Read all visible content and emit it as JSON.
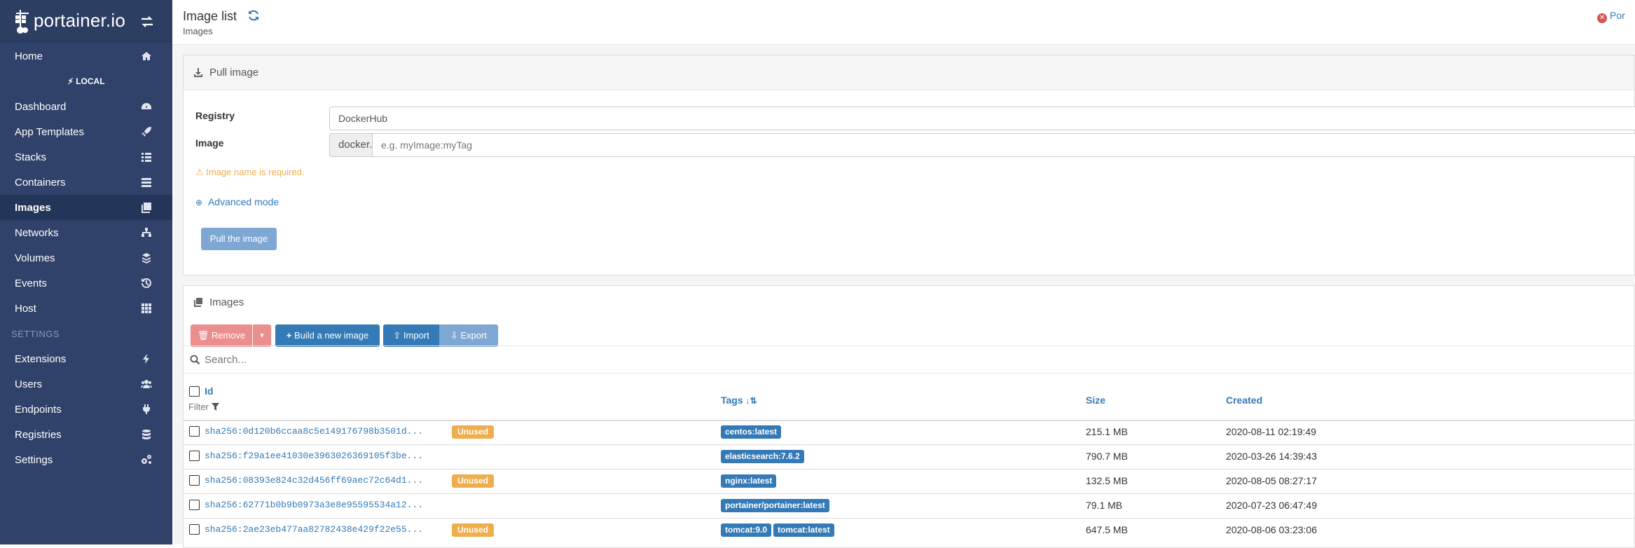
{
  "sidebar": {
    "logo_text": "portainer.io",
    "local_label": "LOCAL",
    "settings_section": "SETTINGS",
    "items": [
      {
        "label": "Home",
        "icon": "home-icon"
      },
      {
        "label": "Dashboard",
        "icon": "dashboard-icon"
      },
      {
        "label": "App Templates",
        "icon": "rocket-icon"
      },
      {
        "label": "Stacks",
        "icon": "stacks-icon"
      },
      {
        "label": "Containers",
        "icon": "containers-icon"
      },
      {
        "label": "Images",
        "icon": "images-icon",
        "active": true
      },
      {
        "label": "Networks",
        "icon": "networks-icon"
      },
      {
        "label": "Volumes",
        "icon": "volumes-icon"
      },
      {
        "label": "Events",
        "icon": "history-icon"
      },
      {
        "label": "Host",
        "icon": "grid-icon"
      },
      {
        "label": "Extensions",
        "icon": "bolt-icon"
      },
      {
        "label": "Users",
        "icon": "users-icon"
      },
      {
        "label": "Endpoints",
        "icon": "plug-icon"
      },
      {
        "label": "Registries",
        "icon": "database-icon"
      },
      {
        "label": "Settings",
        "icon": "cogs-icon"
      }
    ]
  },
  "header": {
    "title": "Image list",
    "breadcrumb": "Images",
    "user_text": "Por"
  },
  "pull_panel": {
    "title": "Pull image",
    "registry_label": "Registry",
    "registry_value": "DockerHub",
    "image_label": "Image",
    "image_prefix": "docker.io",
    "image_placeholder": "e.g. myImage:myTag",
    "warning": "Image name is required.",
    "advanced_mode": "Advanced mode",
    "pull_button": "Pull the image"
  },
  "images_panel": {
    "title": "Images",
    "remove_button": "Remove",
    "build_button": "Build a new image",
    "import_button": "Import",
    "export_button": "Export",
    "search_placeholder": "Search...",
    "columns": {
      "id": "Id",
      "filter": "Filter",
      "tags": "Tags",
      "size": "Size",
      "created": "Created"
    },
    "rows": [
      {
        "id": "sha256:0d120b6ccaa8c5e149176798b3501d...",
        "unused": "Unused",
        "tags": [
          "centos:latest"
        ],
        "size": "215.1 MB",
        "created": "2020-08-11 02:19:49"
      },
      {
        "id": "sha256:f29a1ee41030e3963026369105f3be...",
        "unused": "",
        "tags": [
          "elasticsearch:7.6.2"
        ],
        "size": "790.7 MB",
        "created": "2020-03-26 14:39:43"
      },
      {
        "id": "sha256:08393e824c32d456ff69aec72c64d1...",
        "unused": "Unused",
        "tags": [
          "nginx:latest"
        ],
        "size": "132.5 MB",
        "created": "2020-08-05 08:27:17"
      },
      {
        "id": "sha256:62771b0b9b0973a3e8e95595534a12...",
        "unused": "",
        "tags": [
          "portainer/portainer:latest"
        ],
        "size": "79.1 MB",
        "created": "2020-07-23 06:47:49"
      },
      {
        "id": "sha256:2ae23eb477aa82782438e429f22e55...",
        "unused": "Unused",
        "tags": [
          "tomcat:9.0",
          "tomcat:latest"
        ],
        "size": "647.5 MB",
        "created": "2020-08-06 03:23:06"
      }
    ]
  }
}
